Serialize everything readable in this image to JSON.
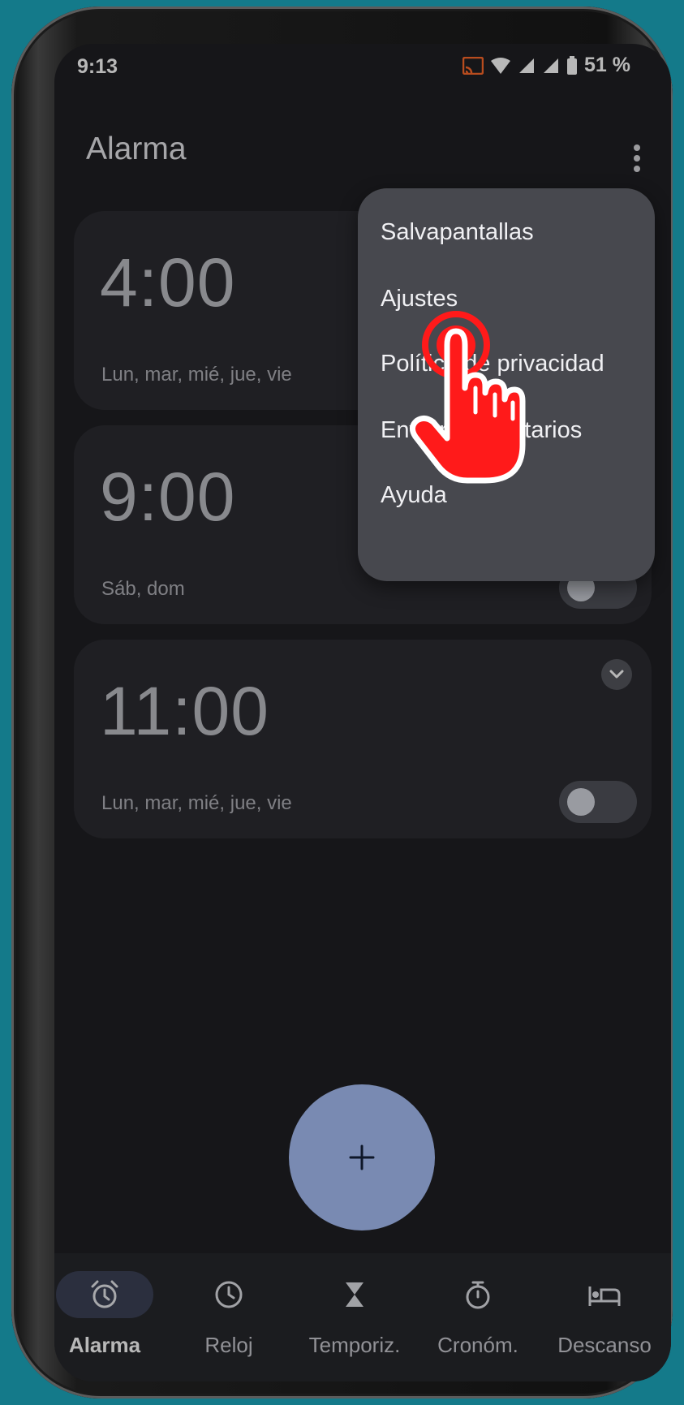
{
  "status_bar": {
    "time": "9:13",
    "battery": "51 %"
  },
  "header": {
    "title": "Alarma"
  },
  "alarms": [
    {
      "time": "4:00",
      "days": "Lun, mar, mié, jue, vie"
    },
    {
      "time": "9:00",
      "days": "Sáb, dom",
      "enabled": false
    },
    {
      "time": "11:00",
      "days": "Lun, mar, mié, jue, vie",
      "enabled": false
    }
  ],
  "overflow_menu": {
    "items": [
      "Salvapantallas",
      "Ajustes",
      "Política de privacidad",
      "Enviar comentarios",
      "Ayuda"
    ]
  },
  "fab": {
    "icon": "plus-icon"
  },
  "bottom_nav": {
    "items": [
      {
        "label": "Alarma",
        "icon": "alarm-clock-icon",
        "active": true
      },
      {
        "label": "Reloj",
        "icon": "clock-icon"
      },
      {
        "label": "Temporiz.",
        "icon": "hourglass-icon"
      },
      {
        "label": "Cronóm.",
        "icon": "stopwatch-icon"
      },
      {
        "label": "Descanso",
        "icon": "bed-icon"
      }
    ]
  },
  "colors": {
    "background": "#147a8a",
    "screen": "#1f1f23",
    "card": "#2b2c31",
    "menu": "#47484e",
    "fab": "#a8c0f7",
    "pointer": "#ff1a1a"
  }
}
